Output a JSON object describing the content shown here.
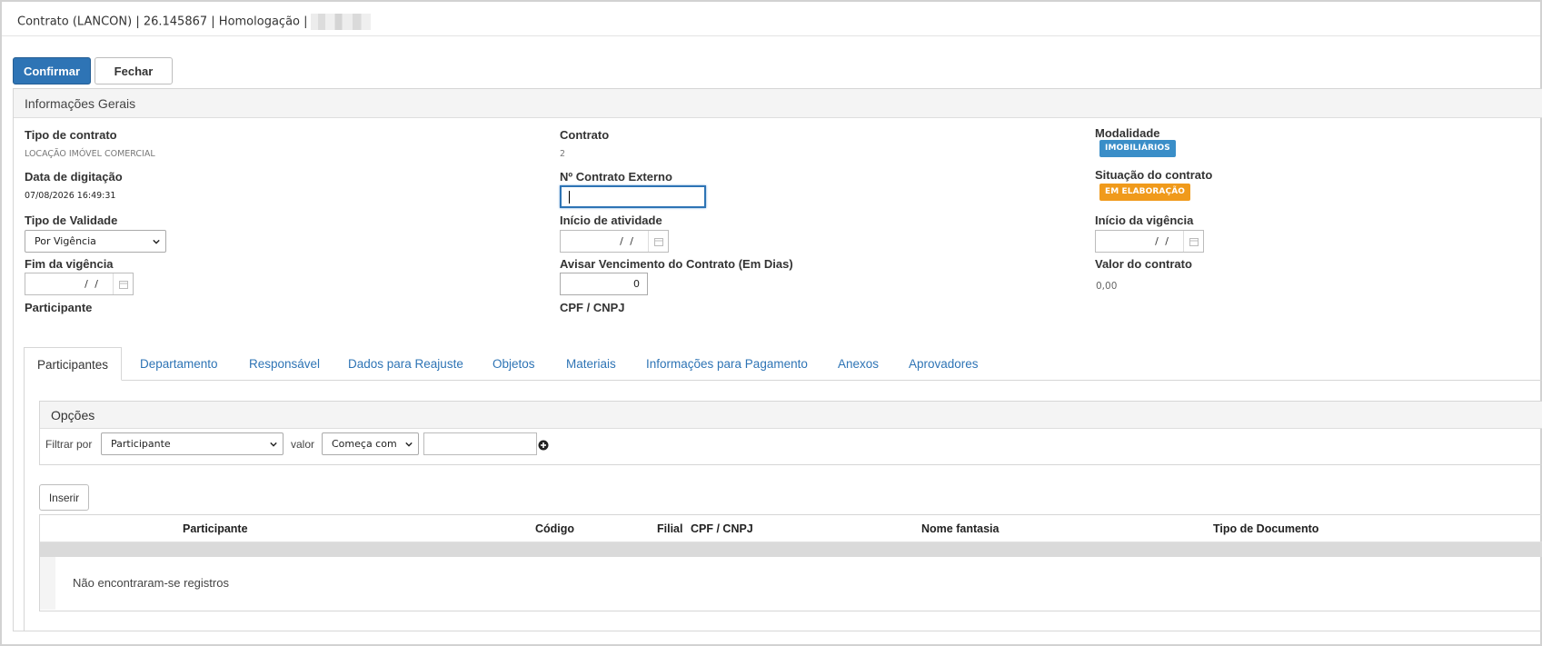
{
  "header": {
    "title": "Contrato (LANCON) | 26.145867 | Homologação |"
  },
  "toolbar": {
    "confirm_label": "Confirmar",
    "close_label": "Fechar"
  },
  "section": {
    "title": "Informações Gerais"
  },
  "fields": {
    "tipo_contrato": {
      "label": "Tipo de contrato",
      "value": "LOCAÇÃO IMÓVEL COMERCIAL"
    },
    "contrato": {
      "label": "Contrato",
      "value": "2"
    },
    "modalidade": {
      "label": "Modalidade",
      "value": "IMOBILIÁRIOS"
    },
    "data_digitacao": {
      "label": "Data de digitação",
      "value": "07/08/2026 16:49:31"
    },
    "contrato_externo": {
      "label": "Nº Contrato Externo",
      "value": ""
    },
    "situacao": {
      "label": "Situação do contrato",
      "value": "EM ELABORAÇÃO"
    },
    "tipo_validade": {
      "label": "Tipo de Validade",
      "value": "Por Vigência"
    },
    "inicio_atividade": {
      "label": "Início de atividade",
      "value": "/ /"
    },
    "inicio_vigencia": {
      "label": "Início da vigência",
      "value": "/ /"
    },
    "fim_vigencia": {
      "label": "Fim da vigência",
      "value": "/ /"
    },
    "avisar_vencimento": {
      "label": "Avisar Vencimento do Contrato (Em Dias)",
      "value": "0"
    },
    "valor_contrato": {
      "label": "Valor do contrato",
      "value": "0,00"
    },
    "participante": {
      "label": "Participante"
    },
    "cpf_cnpj": {
      "label": "CPF / CNPJ"
    }
  },
  "tabs": [
    {
      "label": "Participantes",
      "active": true
    },
    {
      "label": "Departamento"
    },
    {
      "label": "Responsável"
    },
    {
      "label": "Dados para Reajuste"
    },
    {
      "label": "Objetos"
    },
    {
      "label": "Materiais"
    },
    {
      "label": "Informações para Pagamento"
    },
    {
      "label": "Anexos"
    },
    {
      "label": "Aprovadores"
    }
  ],
  "options": {
    "title": "Opções",
    "filter_label": "Filtrar por",
    "filter_value": "Participante",
    "value_label": "valor",
    "operator_value": "Começa com",
    "search_value": ""
  },
  "insert_label": "Inserir",
  "table": {
    "columns": [
      "Participante",
      "Código",
      "Filial",
      "CPF / CNPJ",
      "Nome fantasia",
      "Tipo de Documento"
    ],
    "empty_message": "Não encontraram-se registros"
  },
  "colors": {
    "primary": "#2e74b5",
    "badge_blue": "#3a8ec8",
    "badge_orange": "#f09a1b"
  }
}
